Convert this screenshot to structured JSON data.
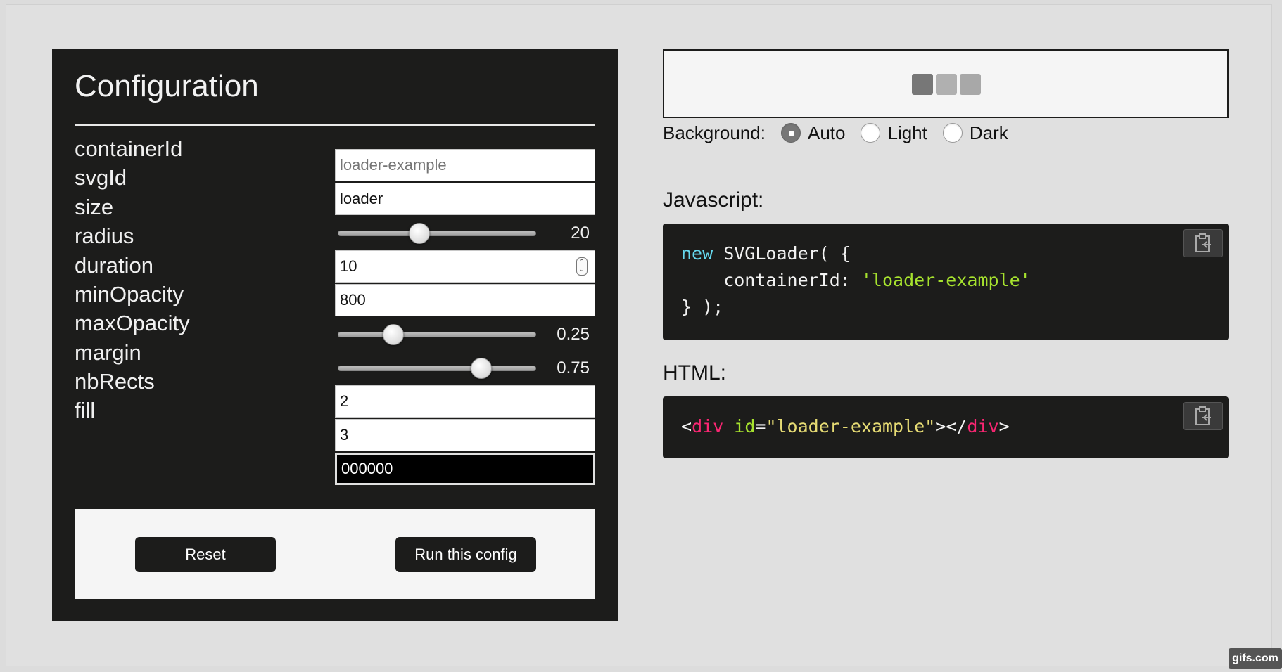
{
  "config": {
    "title": "Configuration",
    "labels": [
      "containerId",
      "svgId",
      "size",
      "radius",
      "duration",
      "minOpacity",
      "maxOpacity",
      "margin",
      "nbRects",
      "fill"
    ],
    "containerId_placeholder": "loader-example",
    "svgId_value": "loader",
    "size": {
      "value": "20",
      "fraction": 0.4
    },
    "radius_value": "10",
    "duration_value": "800",
    "minOpacity": {
      "value": "0.25",
      "fraction": 0.25
    },
    "maxOpacity": {
      "value": "0.75",
      "fraction": 0.75
    },
    "margin_value": "2",
    "nbRects_value": "3",
    "fill_value": "000000",
    "reset_label": "Reset",
    "run_label": "Run this config"
  },
  "preview": {
    "squares": [
      "#777777",
      "#b0b0b0",
      "#a8a8a8"
    ],
    "background_label": "Background:",
    "options": [
      "Auto",
      "Light",
      "Dark"
    ],
    "selected": "Auto"
  },
  "javascript": {
    "title": "Javascript:",
    "kw_new": "new",
    "ctor": " SVGLoader( {",
    "key": "    containerId: ",
    "value": "'loader-example'",
    "close": "} );"
  },
  "html": {
    "title": "HTML:",
    "lt": "<",
    "tag_open": "div",
    "attr_name": " id",
    "eq": "=",
    "attr_value": "\"loader-example\"",
    "gt_lt_slash": "></",
    "tag_close": "div",
    "gt": ">"
  },
  "colors": {
    "panel": "#1c1c1b",
    "background": "#e0e0e0",
    "js_keyword": "#66d9ef",
    "js_string": "#a6e22e",
    "html_tag": "#f92672",
    "html_attr_value": "#e6db74"
  },
  "watermark": "gifs.com"
}
